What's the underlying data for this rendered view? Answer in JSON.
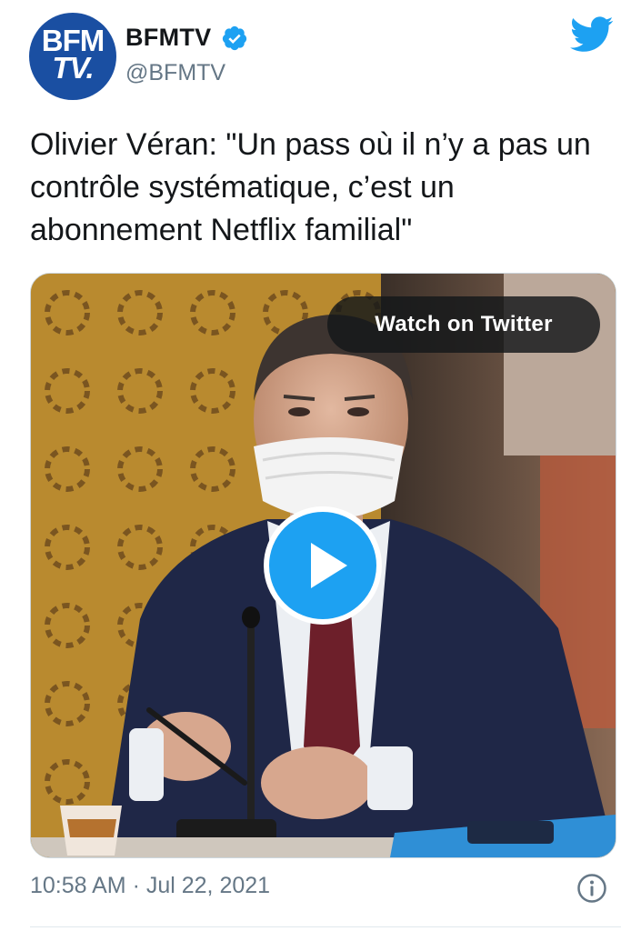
{
  "account": {
    "logo_line1": "BFM",
    "logo_line2": "TV.",
    "display_name": "BFMTV",
    "handle": "@BFMTV",
    "verified": true
  },
  "tweet": {
    "text": "Olivier Véran: \"Un pass où il n’y a pas un contrôle systématique, c’est un abonnement Netflix familial\"",
    "timestamp": "10:58 AM · Jul 22, 2021"
  },
  "media": {
    "watch_label": "Watch on Twitter"
  },
  "icons": {
    "brand": "twitter-bird-icon",
    "verified": "verified-badge-icon",
    "play": "play-icon",
    "info": "info-icon"
  },
  "colors": {
    "twitter_blue": "#1da1f2",
    "bfm_blue": "#1a4fa2",
    "text": "#14171a",
    "secondary_text": "#657786"
  }
}
